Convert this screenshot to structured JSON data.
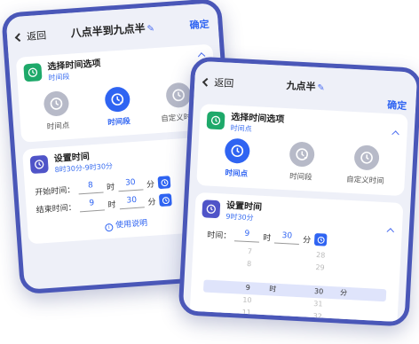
{
  "screen_a": {
    "nav": {
      "back": "返回",
      "title": "八点半到九点半",
      "confirm": "确定"
    },
    "option_card": {
      "title": "选择时间选项",
      "subtitle": "时间段",
      "options": [
        {
          "label": "时间点",
          "state": "inactive"
        },
        {
          "label": "时间段",
          "state": "active"
        },
        {
          "label": "自定义时间",
          "state": "inactive"
        }
      ]
    },
    "time_card": {
      "title": "设置时间",
      "subtitle": "8时30分-9时30分",
      "start": {
        "label": "开始时间：",
        "hour": "8",
        "hour_unit": "时",
        "minute": "30",
        "minute_unit": "分"
      },
      "end": {
        "label": "结束时间：",
        "hour": "9",
        "hour_unit": "时",
        "minute": "30",
        "minute_unit": "分"
      },
      "help": "使用说明"
    }
  },
  "screen_b": {
    "nav": {
      "back": "返回",
      "title": "九点半",
      "confirm": "确定"
    },
    "option_card": {
      "title": "选择时间选项",
      "subtitle": "时间点",
      "options": [
        {
          "label": "时间点",
          "state": "active"
        },
        {
          "label": "时间段",
          "state": "inactive"
        },
        {
          "label": "自定义时间",
          "state": "inactive"
        }
      ]
    },
    "time_card": {
      "title": "设置时间",
      "subtitle": "9时30分",
      "time": {
        "label": "时间：",
        "hour": "9",
        "hour_unit": "时",
        "minute": "30",
        "minute_unit": "分"
      },
      "picker": {
        "hours": [
          "7",
          "8",
          "9",
          "10",
          "11"
        ],
        "minutes": [
          "28",
          "29",
          "30",
          "31",
          "32"
        ],
        "hour_unit": "时",
        "minute_unit": "分"
      }
    }
  },
  "colors": {
    "frame": "#4a57b8",
    "accent": "#2f64f2",
    "green_badge": "#1ea96a",
    "purple_badge": "#4f54c8",
    "inactive": "#b7bac8"
  }
}
